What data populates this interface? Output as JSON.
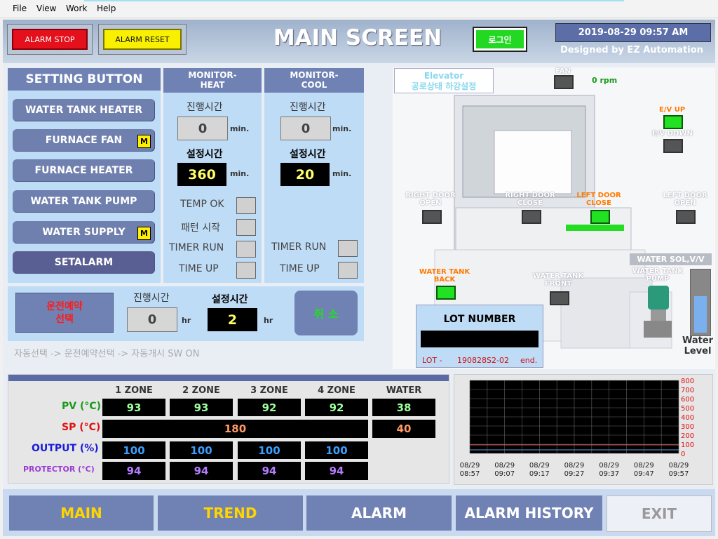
{
  "menu": [
    "File",
    "View",
    "Work",
    "Help"
  ],
  "header": {
    "title": "MAIN SCREEN",
    "alarm_stop": "ALARM STOP",
    "alarm_reset": "ALARM RESET",
    "login": "로그인",
    "datetime": "2019-08-29 09:57 AM",
    "designed_by": "Designed by EZ Automation"
  },
  "setting": {
    "title": "SETTING BUTTON",
    "buttons": [
      "WATER TANK HEATER",
      "FURNACE FAN",
      "FURNACE HEATER",
      "WATER TANK PUMP",
      "WATER SUPPLY",
      "SETALARM"
    ],
    "manual_badge": "M"
  },
  "monitor_heat": {
    "title_line1": "MONITOR-",
    "title_line2": "HEAT",
    "elapsed_label": "진행시간",
    "elapsed_value": "0",
    "set_label": "설정시간",
    "set_value": "360",
    "unit": "min.",
    "status": [
      "TEMP OK",
      "패턴 시작",
      "TIMER RUN",
      "TIME UP"
    ]
  },
  "monitor_cool": {
    "title_line1": "MONITOR-",
    "title_line2": "COOL",
    "elapsed_label": "진행시간",
    "elapsed_value": "0",
    "set_label": "설정시간",
    "set_value": "20",
    "unit": "min.",
    "status": [
      "TIMER RUN",
      "TIME UP"
    ]
  },
  "reservation": {
    "button_line1": "운전예약",
    "button_line2": "선택",
    "elapsed_label": "진행시간",
    "elapsed_value": "0",
    "set_label": "설정시간",
    "set_value": "2",
    "unit": "hr",
    "cancel": "취 소",
    "hint": "자동선택 -> 운전예약선택  -> 자동개시 SW ON"
  },
  "equipment": {
    "elevator_line1": "Elevator",
    "elevator_line2": "공로상태 하강설정",
    "fan_label": "FAN",
    "fan_rpm": "0 rpm",
    "ev_up": "E/V UP",
    "ev_down": "E/V DOWN",
    "right_door_open_1": "RIGHT DOOR",
    "right_door_open_2": "OPEN",
    "right_door_close_1": "RIGHT DOOR",
    "right_door_close_2": "CLOSE",
    "left_door_close_1": "LEFT DOOR",
    "left_door_close_2": "CLOSE",
    "left_door_open_1": "LEFT DOOR",
    "left_door_open_2": "OPEN",
    "water_tank_back_1": "WATER TANK",
    "water_tank_back_2": "BACK",
    "water_tank_front_1": "WATER TANK",
    "water_tank_front_2": "FRONT",
    "water_sol": "WATER SOL,V/V",
    "water_tank_pump_1": "WATER TANK",
    "water_tank_pump_2": "PUMP",
    "water_level_1": "Water",
    "water_level_2": "Level",
    "water_level_fraction": 0.6
  },
  "lot": {
    "title": "LOT NUMBER",
    "value": "",
    "prefix": "LOT -",
    "code": "190828S2-02",
    "suffix": "end."
  },
  "zones": {
    "headers": [
      "1 ZONE",
      "2 ZONE",
      "3 ZONE",
      "4 ZONE",
      "WATER"
    ],
    "pv_label": "PV (°C)",
    "pv": [
      "93",
      "93",
      "92",
      "92",
      "38"
    ],
    "sp_label": "SP (°C)",
    "sp_zone": "180",
    "sp_water": "40",
    "output_label": "OUTPUT (%)",
    "output": [
      "100",
      "100",
      "100",
      "100"
    ],
    "protector_label": "PROTECTOR  (°C)",
    "protector": [
      "94",
      "94",
      "94",
      "94"
    ],
    "colors": {
      "pv": "#9cff9c",
      "sp": "#ff9a66",
      "output": "#3aa0ff",
      "protector": "#b57cff"
    }
  },
  "chart_data": {
    "type": "line",
    "y_ticks": [
      "800",
      "700",
      "600",
      "500",
      "400",
      "300",
      "200",
      "100",
      "0"
    ],
    "ylim": [
      0,
      800
    ],
    "x_ticks": [
      {
        "date": "08/29",
        "time": "08:57"
      },
      {
        "date": "08/29",
        "time": "09:07"
      },
      {
        "date": "08/29",
        "time": "09:17"
      },
      {
        "date": "08/29",
        "time": "09:27"
      },
      {
        "date": "08/29",
        "time": "09:37"
      },
      {
        "date": "08/29",
        "time": "09:47"
      },
      {
        "date": "08/29",
        "time": "09:57"
      }
    ],
    "grid": true,
    "series": [
      {
        "values": [
          93,
          93,
          93,
          93,
          93,
          93,
          93
        ]
      },
      {
        "values": [
          38,
          38,
          38,
          38,
          38,
          38,
          38
        ]
      }
    ]
  },
  "nav": [
    "MAIN",
    "TREND",
    "ALARM",
    "ALARM HISTORY",
    "EXIT"
  ]
}
